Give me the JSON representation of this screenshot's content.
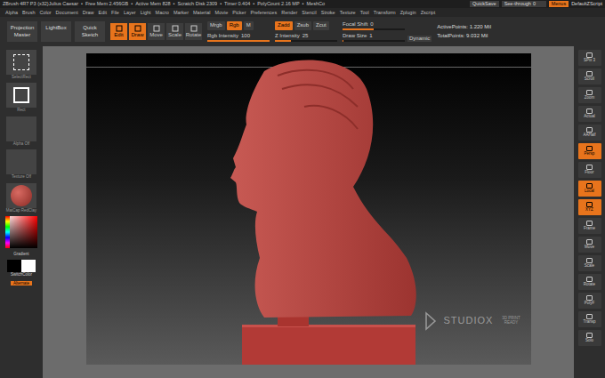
{
  "title_bar": {
    "title": "ZBrush 4R7 P3 (x32)Julius Caesar",
    "separator": "•",
    "stats": [
      "Free Mem 2.456GB",
      "Active Mem 828",
      "Scratch Disk 2309",
      "Timer 0.404",
      "PolyCount 2.16 MP",
      "MeshCo"
    ],
    "quicksave": "QuickSave",
    "see_through": {
      "label": "See-through",
      "value": "0",
      "level": 0
    },
    "menus": {
      "label": "Menus",
      "selected": true
    },
    "script": "DefaultZScript"
  },
  "menu": [
    "Alpha",
    "Brush",
    "Color",
    "Document",
    "Draw",
    "Edit",
    "File",
    "Layer",
    "Light",
    "Macro",
    "Marker",
    "Material",
    "Movie",
    "Picker",
    "Preferences",
    "Render",
    "Stencil",
    "Stroke",
    "Texture",
    "Tool",
    "Transform",
    "Zplugin",
    "Zscript"
  ],
  "toolbar": {
    "left_buttons": [
      "Projection Master",
      "LightBox",
      "Quick Sketch"
    ],
    "modes": [
      {
        "label": "Edit",
        "selected": true
      },
      {
        "label": "Draw",
        "selected": true
      },
      {
        "label": "Move",
        "selected": false
      },
      {
        "label": "Scale",
        "selected": false
      },
      {
        "label": "Rotate",
        "selected": false
      }
    ],
    "color_modes": [
      {
        "label": "Mrgb",
        "selected": false
      },
      {
        "label": "Rgb",
        "selected": true
      },
      {
        "label": "M",
        "selected": false
      }
    ],
    "z_modes": [
      {
        "label": "Zadd",
        "selected": true,
        "disabled": false
      },
      {
        "label": "Zsub",
        "selected": false,
        "disabled": false
      },
      {
        "label": "Zcut",
        "selected": false,
        "disabled": true
      }
    ],
    "sliders": [
      {
        "label": "Rgb Intensity",
        "value": "100",
        "level": 1
      },
      {
        "label": "Z Intensity",
        "value": "25",
        "level": 0.25
      },
      {
        "label": "Focal Shift",
        "value": "0",
        "level": 0.5
      },
      {
        "label": "Draw Size",
        "value": "1",
        "level": 0.01
      }
    ],
    "dynamic": "Dynamic",
    "points": [
      "ActivePoints: 1.220 Mil",
      "TotalPoints: 9.032 Mil"
    ]
  },
  "left_panel": {
    "items": [
      "SelectRect",
      "Rect",
      "Alpha Off",
      "Texture Off",
      "MatCap RedClay"
    ],
    "gradient": "Gradient",
    "switch_color": "SwitchColor",
    "alternate": {
      "label": "Alternate",
      "selected": true
    }
  },
  "right_shelf": [
    {
      "label": "SPix 3",
      "selected": false
    },
    {
      "label": "Scroll",
      "selected": false
    },
    {
      "label": "Zoom",
      "selected": false
    },
    {
      "label": "Actual",
      "selected": false
    },
    {
      "label": "AAHalf",
      "selected": false
    },
    {
      "label": "Persp",
      "selected": true
    },
    {
      "label": "Floor",
      "selected": false
    },
    {
      "label": "Local",
      "selected": true
    },
    {
      "label": "XYZ",
      "selected": true
    },
    {
      "label": "Frame",
      "selected": false
    },
    {
      "label": "Move",
      "selected": false
    },
    {
      "label": "Scale",
      "selected": false
    },
    {
      "label": "Rotate",
      "selected": false
    },
    {
      "label": "PolyF",
      "selected": false
    },
    {
      "label": "Transp",
      "selected": false
    },
    {
      "label": "Solo",
      "selected": false
    }
  ],
  "watermark": {
    "brand": "STUDIOX",
    "tagline": "3D PRINT READY"
  }
}
